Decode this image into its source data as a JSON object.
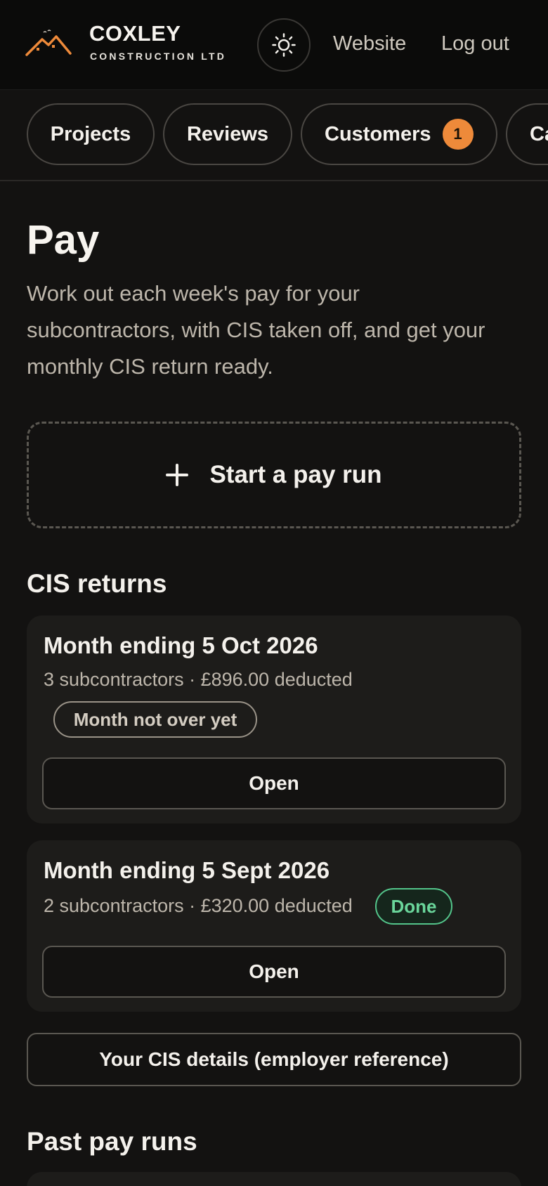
{
  "header": {
    "brand_name": "COXLEY",
    "brand_sub": "CONSTRUCTION LTD",
    "logo_icon": "house-roof-icon",
    "theme_icon": "sun-icon",
    "links": {
      "website": "Website",
      "logout": "Log out"
    },
    "accent_color": "#ee8a3a"
  },
  "nav": {
    "tabs": [
      {
        "label": "Projects"
      },
      {
        "label": "Reviews"
      },
      {
        "label": "Customers",
        "badge": "1"
      },
      {
        "label": "Ca"
      }
    ]
  },
  "page": {
    "title": "Pay",
    "description": "Work out each week's pay for your subcontractors, with CIS taken off, and get your monthly CIS return ready.",
    "start_run_label": "Start a pay run"
  },
  "cis_returns": {
    "heading": "CIS returns",
    "items": [
      {
        "title": "Month ending 5 Oct 2026",
        "meta": "3 subcontractors · £896.00 deducted",
        "status": "Month not over yet",
        "open_label": "Open"
      },
      {
        "title": "Month ending 5 Sept 2026",
        "meta": "2 subcontractors · £320.00 deducted",
        "status": "Done",
        "open_label": "Open"
      }
    ],
    "details_button": "Your CIS details (employer reference)"
  },
  "past_runs": {
    "heading": "Past pay runs"
  }
}
